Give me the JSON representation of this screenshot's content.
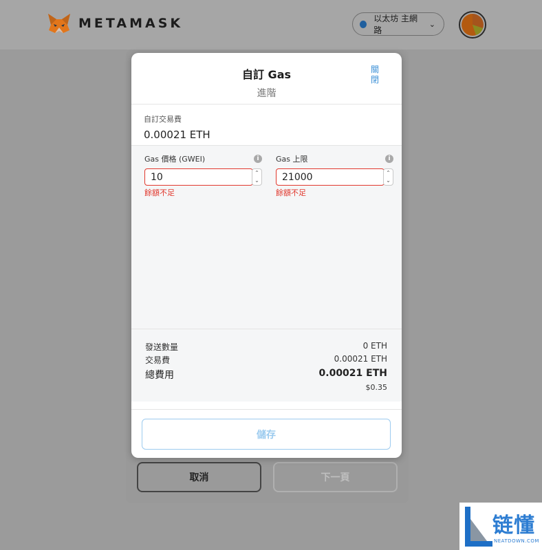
{
  "header": {
    "brand": "METAMASK",
    "network_label": "以太坊 主網路",
    "network_chevron": "⌄"
  },
  "background": {
    "cancel_label": "取消",
    "next_label": "下一頁"
  },
  "modal": {
    "title": "自訂 Gas",
    "tab": "進階",
    "close_label": "關閉",
    "fee_label": "自訂交易費",
    "fee_value": "0.00021 ETH",
    "gas_price": {
      "label": "Gas 價格 (GWEI)",
      "value": "10",
      "error": "餘額不足"
    },
    "gas_limit": {
      "label": "Gas 上限",
      "value": "21000",
      "error": "餘額不足"
    },
    "summary": {
      "send_label": "發送數量",
      "send_value": "0 ETH",
      "fee_label": "交易費",
      "fee_value": "0.00021 ETH",
      "total_label": "總費用",
      "total_value": "0.00021 ETH",
      "total_usd": "$0.35"
    },
    "save_label": "儲存"
  },
  "watermark": {
    "text": "链懂",
    "sub": "NEATDOWN.COM"
  },
  "colors": {
    "accent": "#3a8fd6",
    "error": "#e1372c",
    "network_dot": "#1f5f9e"
  }
}
